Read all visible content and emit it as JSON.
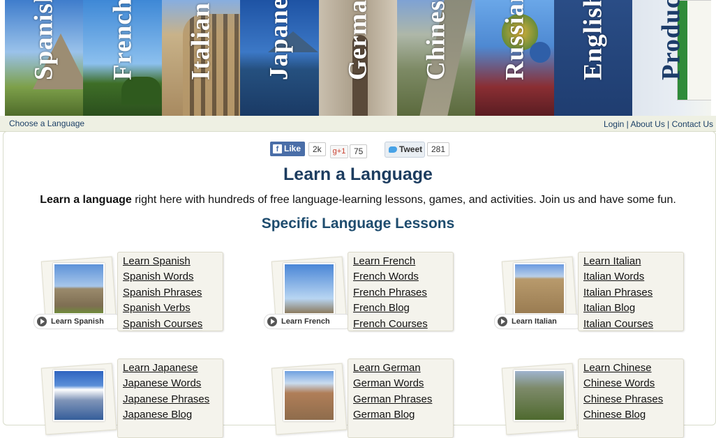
{
  "banner": {
    "tiles": [
      {
        "label": "Spanish"
      },
      {
        "label": "French"
      },
      {
        "label": "Italian"
      },
      {
        "label": "Japanese"
      },
      {
        "label": "German"
      },
      {
        "label": "Chinese"
      },
      {
        "label": "Russian"
      },
      {
        "label": "English"
      },
      {
        "label": "Products"
      }
    ]
  },
  "subnav": {
    "choose": "Choose a Language",
    "login": "Login",
    "about": "About Us",
    "contact": "Contact Us",
    "sep": "|"
  },
  "social": {
    "like_label": "Like",
    "like_count": "2k",
    "gplus_label": "g+1",
    "gplus_count": "75",
    "tweet_label": "Tweet",
    "tweet_count": "281"
  },
  "main": {
    "title": "Learn a Language",
    "intro_bold": "Learn a language",
    "intro_rest": " right here with hundreds of free language-learning lessons, games, and activities. Join us and have some fun.",
    "subtitle": "Specific Language Lessons"
  },
  "cards": [
    {
      "button": "Learn Spanish",
      "links": [
        "Learn Spanish",
        "Spanish Words",
        "Spanish Phrases",
        "Spanish Verbs",
        "Spanish Courses"
      ]
    },
    {
      "button": "Learn French",
      "links": [
        "Learn French",
        "French Words",
        "French Phrases",
        "French Blog",
        "French Courses"
      ]
    },
    {
      "button": "Learn Italian",
      "links": [
        "Learn Italian",
        "Italian Words",
        "Italian Phrases",
        "Italian Blog",
        "Italian Courses"
      ]
    },
    {
      "button": "",
      "links": [
        "Learn Japanese",
        "Japanese Words",
        "Japanese Phrases",
        "Japanese Blog"
      ]
    },
    {
      "button": "",
      "links": [
        "Learn German",
        "German Words",
        "German Phrases",
        "German Blog"
      ]
    },
    {
      "button": "",
      "links": [
        "Learn Chinese",
        "Chinese Words",
        "Chinese Phrases",
        "Chinese Blog"
      ]
    }
  ]
}
